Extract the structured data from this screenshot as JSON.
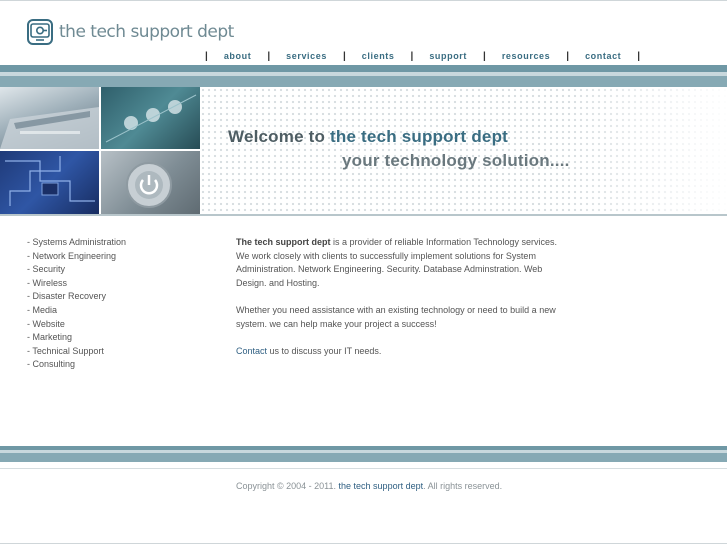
{
  "brand": {
    "name": "the tech support dept",
    "accent_color": "#3a6d82",
    "logo_icon": "monitor-plug-icon"
  },
  "nav": {
    "separator": "|",
    "items": [
      {
        "label": "about"
      },
      {
        "label": "services"
      },
      {
        "label": "clients"
      },
      {
        "label": "support"
      },
      {
        "label": "resources"
      },
      {
        "label": "contact"
      }
    ]
  },
  "hero": {
    "welcome_prefix": "Welcome to ",
    "welcome_name": "the tech support dept",
    "tagline": "your technology solution...."
  },
  "services": [
    "- Systems Administration",
    "- Network Engineering",
    "- Security",
    "- Wireless",
    "- Disaster Recovery",
    "- Media",
    "- Website",
    "- Marketing",
    "- Technical Support",
    "- Consulting"
  ],
  "content": {
    "intro_bold": "The tech support dept",
    "intro_rest": " is a provider of reliable Information Technology services. We work closely with clients to successfully implement solutions for System Administration. Network Engineering. Security. Database Adminstration. Web Design. and Hosting.",
    "paragraph2": "Whether you need assistance with an existing technology or need to build a new system. we can help make your project a success!",
    "contact_link": "Contact",
    "contact_rest": " us to discuss your IT needs."
  },
  "footer": {
    "copyright_prefix": "Copyright © 2004 - 2011. ",
    "company_link": "the tech support dept",
    "rights": ". All rights reserved."
  }
}
